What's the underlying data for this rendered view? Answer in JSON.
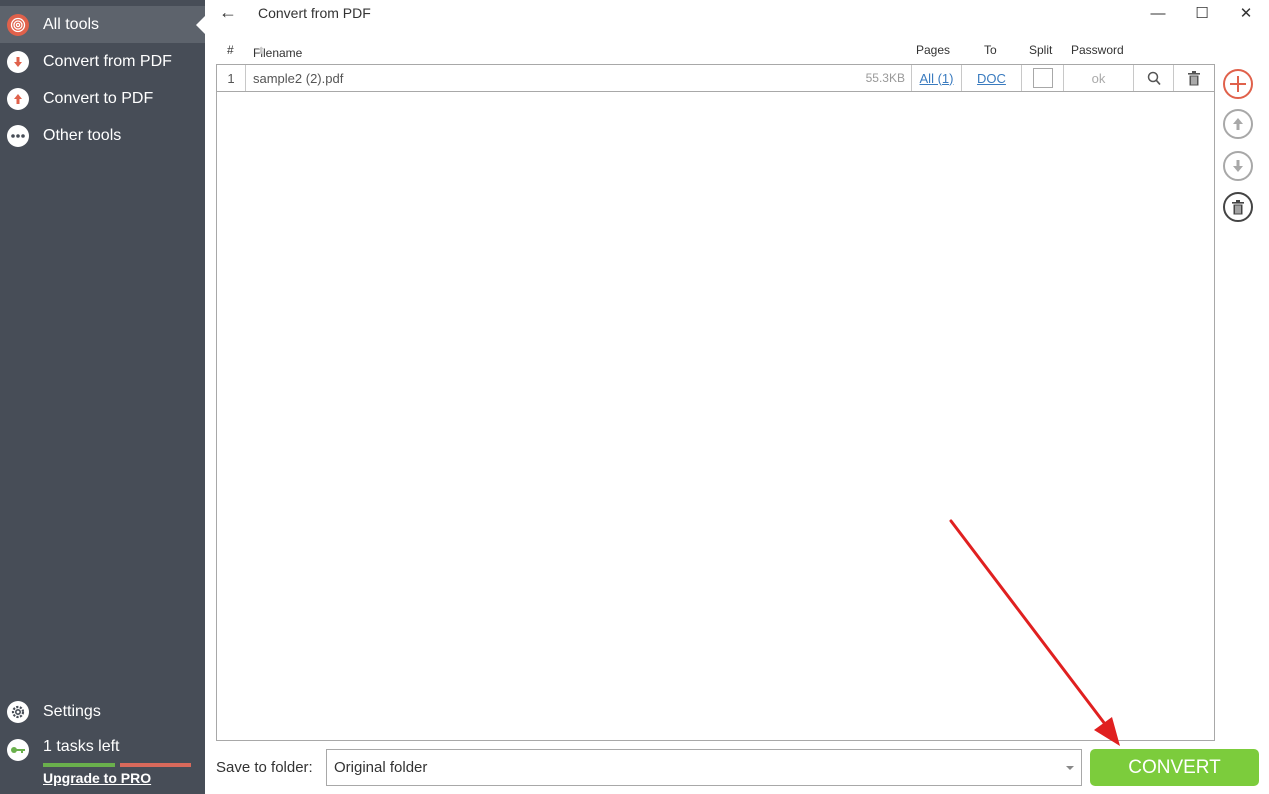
{
  "sidebar": {
    "items": [
      {
        "label": "All tools",
        "icon": "spiral-icon",
        "active": true
      },
      {
        "label": "Convert from PDF",
        "icon": "arrow-down-icon",
        "active": false
      },
      {
        "label": "Convert to PDF",
        "icon": "arrow-up-icon",
        "active": false
      },
      {
        "label": "Other tools",
        "icon": "ellipsis-icon",
        "active": false
      }
    ],
    "settings_label": "Settings",
    "tasks_label": "1 tasks left",
    "upgrade_label": "Upgrade to PRO",
    "tasks_used_fraction": 0.5
  },
  "titlebar": {
    "back_icon": "←",
    "title": "Convert from PDF",
    "minimize": "—",
    "maximize": "☐",
    "close": "✕"
  },
  "table": {
    "headers": {
      "index": "#",
      "filename": "Filename",
      "pages": "Pages",
      "to": "To",
      "split": "Split",
      "password": "Password"
    },
    "rows": [
      {
        "index": "1",
        "filename": "sample2 (2).pdf",
        "size": "55.3KB",
        "pages": "All (1)",
        "to": "DOC",
        "split": false,
        "password": "ok"
      }
    ]
  },
  "bottom": {
    "save_label": "Save to folder:",
    "folder_value": "Original folder",
    "convert_label": "CONVERT"
  },
  "colors": {
    "sidebar_bg": "#474d57",
    "accent_red": "#e0614b",
    "convert_green": "#7ccc3c",
    "link_blue": "#3a7bbf",
    "annotation_arrow": "#e02020"
  }
}
